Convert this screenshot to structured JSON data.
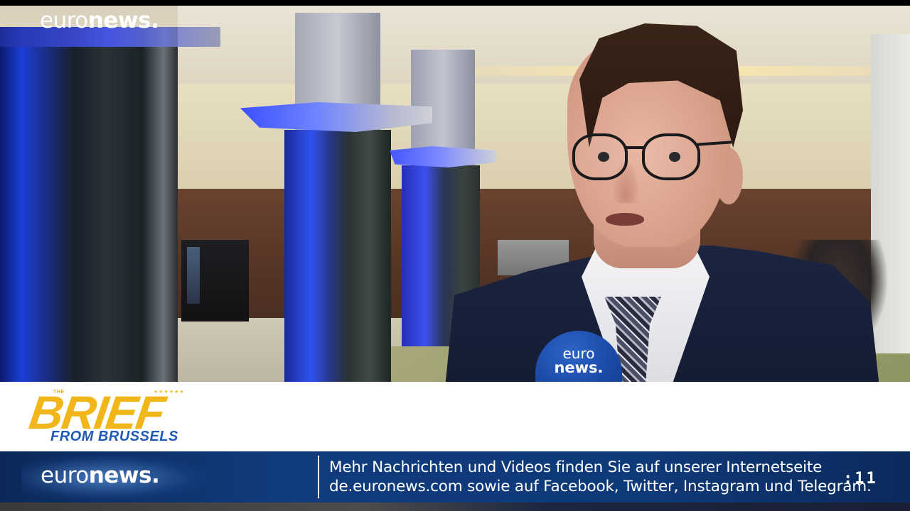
{
  "top_logo": {
    "part1": "euro",
    "part2": "news",
    "dot": "."
  },
  "microphone": {
    "line1": "euro",
    "line2": "news."
  },
  "program": {
    "small_text": "THE",
    "stars": "★★★★★★",
    "title": "BRIEF",
    "subtitle": "FROM BRUSSELS"
  },
  "ticker": {
    "logo_part1": "euro",
    "logo_part2": "news",
    "logo_dot": ".",
    "line1": "Mehr Nachrichten und Videos finden Sie auf unserer Internetseite",
    "line2": "de.euronews.com sowie auf Facebook, Twitter, Instagram und Telegram.",
    "timer": ":11"
  },
  "colors": {
    "brief_yellow": "#f0b61a",
    "brief_blue": "#1f5bb8",
    "ticker_blue": "#103b7c"
  }
}
